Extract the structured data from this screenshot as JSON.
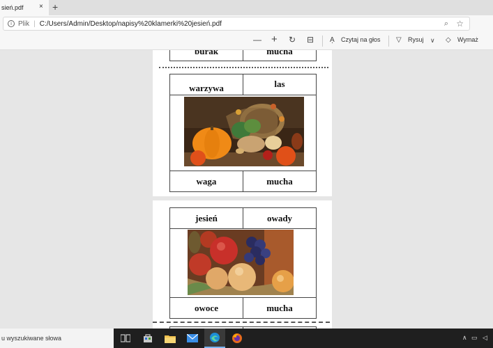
{
  "tab": {
    "title": "sień.pdf",
    "close": "×",
    "new_tab": "+"
  },
  "address": {
    "label": "Plik",
    "url": "C:/Users/Admin/Desktop/napisy%20klamerki%20jesień.pdf"
  },
  "pdf_toolbar": {
    "zoom_out": "—",
    "zoom_in": "+",
    "read_aloud": "Czytaj na głos",
    "draw": "Rysuj",
    "erase": "Wymaż"
  },
  "page1": {
    "top_row": [
      "burak",
      "mucha"
    ],
    "card": {
      "top": [
        "warzywa",
        "las"
      ],
      "bottom": [
        "waga",
        "mucha"
      ]
    }
  },
  "page2": {
    "card": {
      "top": [
        "jesień",
        "owady"
      ],
      "bottom": [
        "owoce",
        "mucha"
      ]
    }
  },
  "taskbar": {
    "search_placeholder": "u wyszukiwane słowa"
  }
}
